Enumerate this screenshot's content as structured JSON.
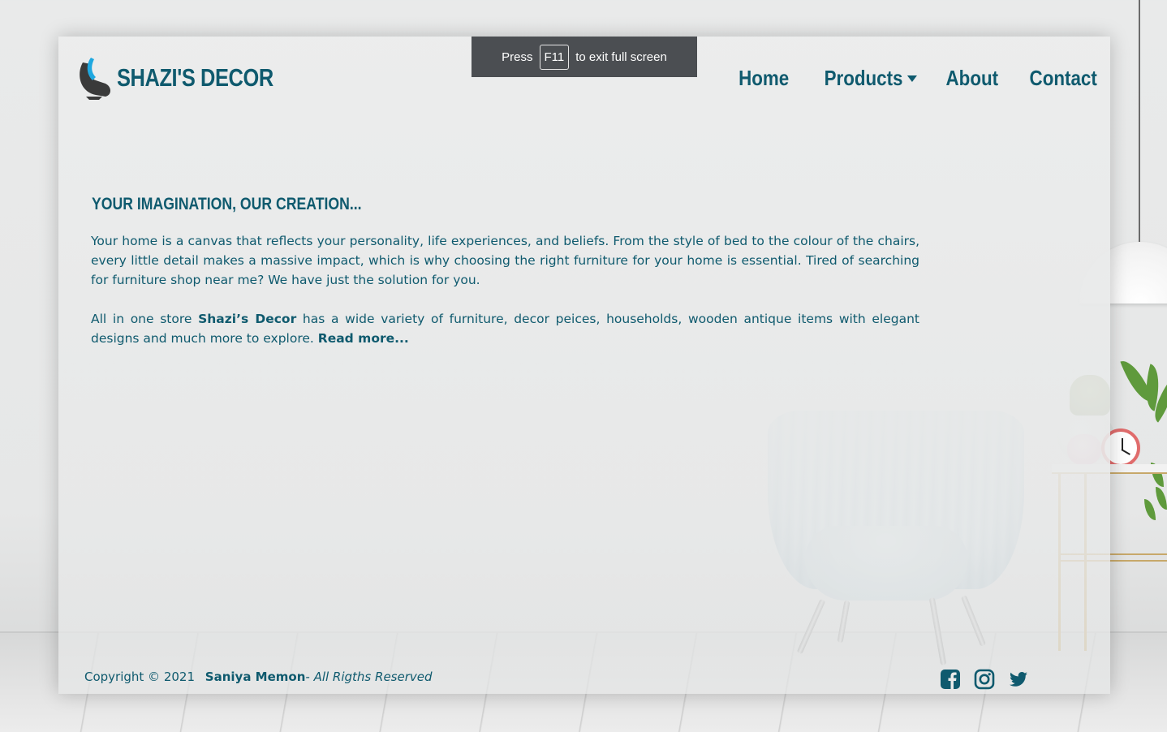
{
  "brand": {
    "name": "SHAZI'S DECOR",
    "logo_icon": "egg-chair-icon",
    "accent": "#0f5a6e"
  },
  "nav": {
    "items": [
      {
        "label": "Home"
      },
      {
        "label": "Products",
        "has_dropdown": true
      },
      {
        "label": "About"
      },
      {
        "label": "Contact"
      }
    ]
  },
  "overlay": {
    "press": "Press",
    "key": "F11",
    "message": "to exit full screen"
  },
  "hero": {
    "headline": "YOUR IMAGINATION, OUR CREATION...",
    "paragraph1": "Your home is a canvas that reflects your personality, life experiences, and beliefs. From the style of bed to the colour of the chairs, every little detail makes a massive impact, which is why choosing the right furniture for your home is essential. Tired of searching for furniture shop near me? We have just the solution for you.",
    "paragraph2_prefix": "All in one store ",
    "paragraph2_store": "Shazi’s Decor",
    "paragraph2_body": " has a wide variety of furniture, decor peices, households, wooden antique items with elegant designs and much more to explore. ",
    "read_more": "Read more..."
  },
  "footer": {
    "copyright": "Copyright © 2021",
    "author": "Saniya Memon",
    "rights": "- All Rigths Reserved",
    "social": [
      "facebook-icon",
      "instagram-icon",
      "twitter-icon"
    ]
  }
}
